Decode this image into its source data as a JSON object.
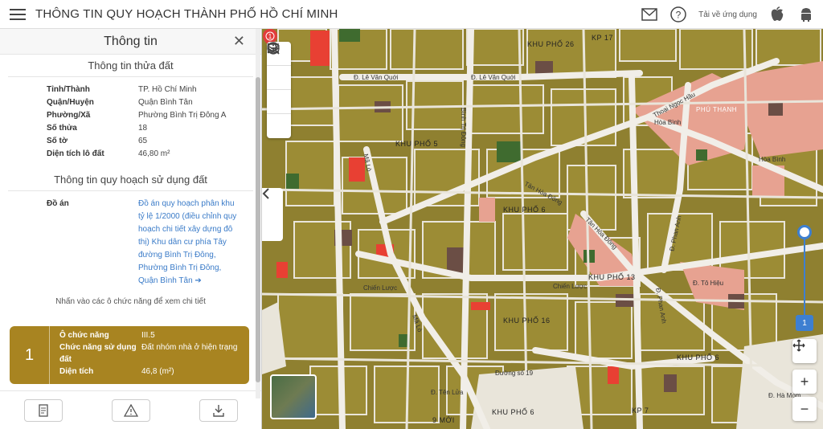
{
  "header": {
    "title": "THÔNG TIN QUY HOẠCH THÀNH PHỐ HỒ CHÍ MINH",
    "download_label": "Tải về ứng dụng"
  },
  "panel": {
    "title": "Thông tin",
    "land_section_title": "Thông tin thửa đất",
    "land_info": [
      {
        "key": "Tỉnh/Thành",
        "value": "TP. Hồ Chí Minh"
      },
      {
        "key": "Quận/Huyện",
        "value": "Quận Bình Tân"
      },
      {
        "key": "Phường/Xã",
        "value": "Phường Bình Trị Đông A"
      },
      {
        "key": "Số thửa",
        "value": "18"
      },
      {
        "key": "Số tờ",
        "value": "65"
      },
      {
        "key": "Diện tích lô đất",
        "value": "46,80 m²"
      }
    ],
    "planning_section_title": "Thông tin quy hoạch sử dụng đất",
    "project_key": "Đồ án",
    "project_value": "Đồ án quy hoạch phân khu tỷ lệ 1/2000 (điều chỉnh quy hoạch chi tiết xây dựng đô thị) Khu dân cư phía Tây đường Bình Trị Đông, Phường Bình Trị Đông, Quận Bình Tân ➔",
    "hint": "Nhấn vào các ô chức năng để xem chi tiết",
    "function_box": {
      "number": "1",
      "rows": [
        {
          "key": "Ô chức năng",
          "value": "III.5"
        },
        {
          "key": "Chức năng sử dụng đất",
          "value": "Đất nhóm nhà ở hiện trạng"
        },
        {
          "key": "Diện tích",
          "value": "46,8 (m²)"
        }
      ]
    }
  },
  "map": {
    "zoom_level": "1",
    "labels": [
      "KHU PHỐ 26",
      "KP 17",
      "KHU PHỐ 5",
      "KHU PHỐ 6",
      "KHU PHỐ 13",
      "KHU PHỐ 16",
      "KHU PHỐ 6",
      "KHU PHỐ 6",
      "9 MỚI",
      "PHÚ THẠNH",
      "KP 7"
    ],
    "streets": [
      "Đ. Lê Văn Quới",
      "Đ. Lê Văn Quới",
      "Thoại Ngọc Hầu",
      "Hòa Bình",
      "Hòa Bình",
      "Tân Hòa Đông",
      "Tân Hòa Đông",
      "Chiến Lược",
      "Chiến Lược",
      "Mã Lò",
      "Mã Lò",
      "Bình Trị Đông",
      "Đ. Phan Anh",
      "Đ. Phan Anh",
      "Đ. Tô Hiệu",
      "Đường số 19",
      "Đ. Tên Lửa",
      "Đ. Hà Mom"
    ]
  }
}
